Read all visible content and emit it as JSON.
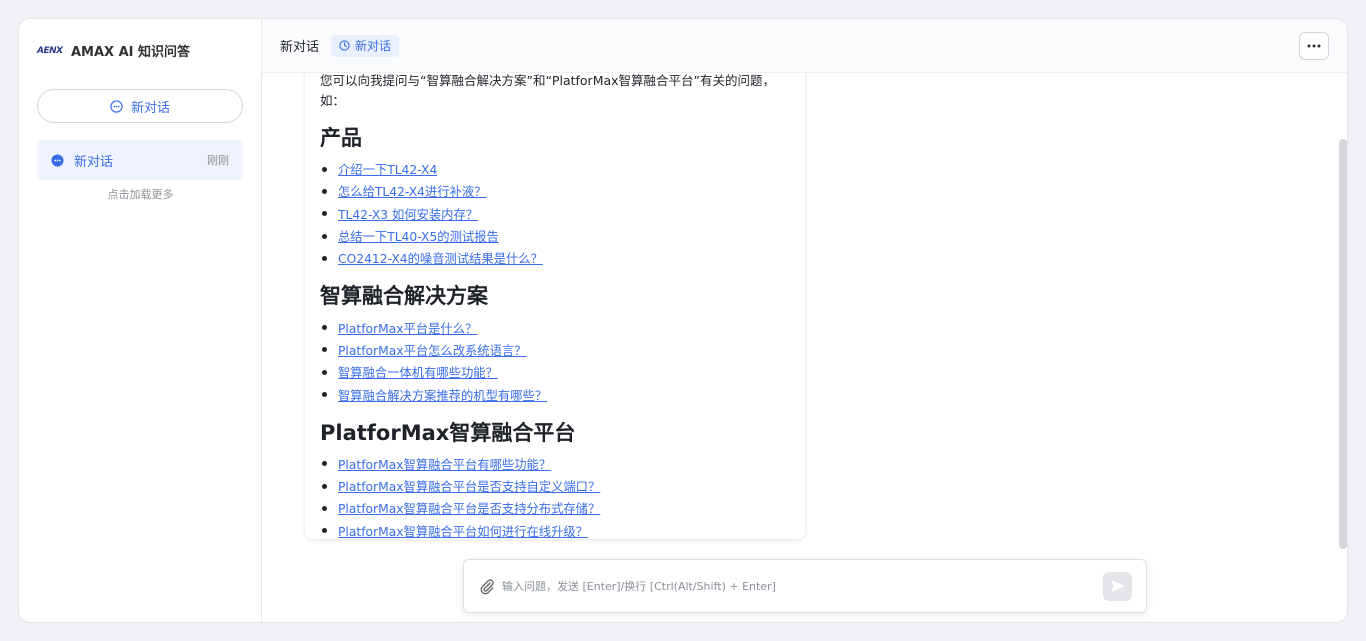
{
  "sidebar": {
    "brand_logo": "AENX",
    "brand_name": "AMAX AI 知识问答",
    "new_chat_label": "新对话",
    "items": [
      {
        "label": "新对话",
        "time": "刚刚"
      }
    ],
    "load_more": "点击加载更多"
  },
  "header": {
    "title": "新对话",
    "tag": "新对话"
  },
  "answer": {
    "intro": "您可以向我提问与“智算融合解决方案”和“PlatforMax智算融合平台”有关的问题，如：",
    "sections": [
      {
        "title": "产品",
        "questions": [
          "介绍一下TL42-X4",
          "怎么给TL42-X4进行补液？",
          "TL42-X3 如何安装内存？",
          "总结一下TL40-X5的测试报告",
          "CO2412-X4的噪音测试结果是什么？"
        ]
      },
      {
        "title": "智算融合解决方案",
        "questions": [
          "PlatforMax平台是什么？",
          "PlatforMax平台怎么改系统语言？",
          "智算融合一体机有哪些功能？",
          "智算融合解决方案推荐的机型有哪些？"
        ]
      },
      {
        "title": "PlatforMax智算融合平台",
        "questions": [
          "PlatforMax智算融合平台有哪些功能？",
          "PlatforMax智算融合平台是否支持自定义端口？",
          "PlatforMax智算融合平台是否支持分布式存储？",
          "PlatforMax智算融合平台如何进行在线升级？"
        ]
      }
    ]
  },
  "input": {
    "placeholder": "输入问题，发送 [Enter]/换行 [Ctrl(Alt/Shift) + Enter]",
    "value": ""
  },
  "colors": {
    "accent": "#3a6ee8",
    "active_bg": "#eef3fe"
  }
}
